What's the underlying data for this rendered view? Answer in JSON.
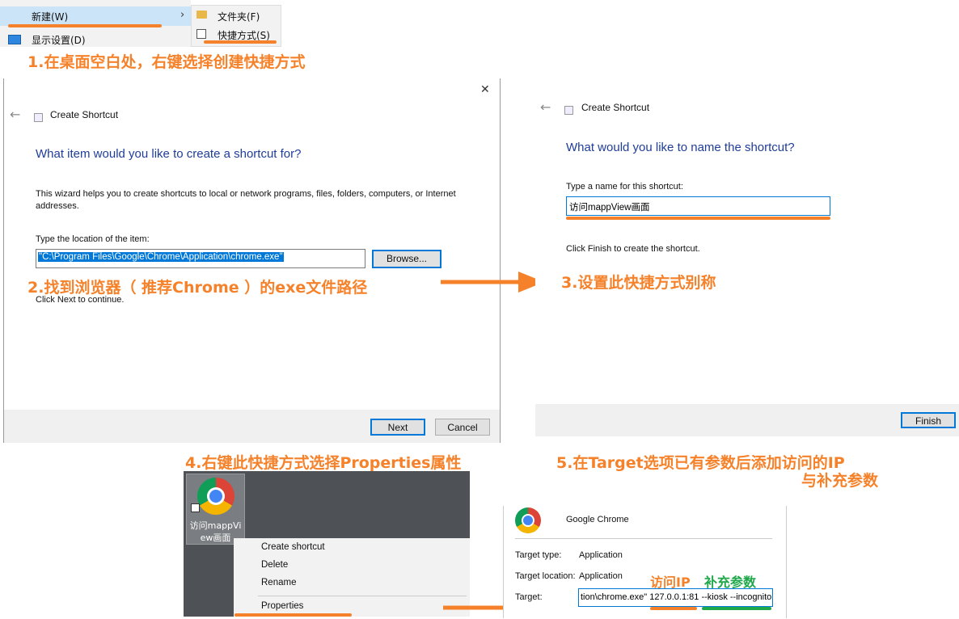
{
  "colors": {
    "accent": "#f5822a",
    "green": "#1fa84a",
    "wizard_blue": "#1f3d99",
    "selection": "#0078d7"
  },
  "context_menu_top": {
    "new_label": "新建(W)",
    "display_settings_label": "显示设置(D)",
    "submenu": [
      {
        "label": "文件夹(F)",
        "icon": "folder-icon"
      },
      {
        "label": "快捷方式(S)",
        "icon": "shortcut-icon"
      }
    ]
  },
  "steps": {
    "step1": "1.在桌面空白处，右键选择创建快捷方式",
    "step2": "2.找到浏览器（ 推荐Chrome ）的exe文件路径",
    "step3": "3.设置此快捷方式别称",
    "step4": "4.右键此快捷方式选择Properties属性",
    "step5_line1": "5.在Target选项已有参数后添加访问的IP",
    "step5_line2": "与补充参数"
  },
  "wizard1": {
    "title": "Create Shortcut",
    "heading": "What item would you like to create a shortcut for?",
    "description": "This wizard helps you to create shortcuts to local or network programs, files, folders, computers, or Internet addresses.",
    "location_label": "Type the location of the item:",
    "location_value": "\"C:\\Program Files\\Google\\Chrome\\Application\\chrome.exe\"",
    "browse_label": "Browse...",
    "continue_text": "Click Next to continue.",
    "next_label": "Next",
    "cancel_label": "Cancel",
    "close_glyph": "✕"
  },
  "wizard2": {
    "title": "Create Shortcut",
    "heading": "What would you like to name the shortcut?",
    "name_label": "Type a name for this shortcut:",
    "name_value": "访问mappView画面",
    "finish_text": "Click Finish to create the shortcut.",
    "finish_label": "Finish"
  },
  "desktop": {
    "icon_label": "访问mappView画面",
    "context_menu": [
      "Create shortcut",
      "Delete",
      "Rename",
      "Properties"
    ]
  },
  "properties": {
    "app_name": "Google Chrome",
    "target_type_label": "Target type:",
    "target_type_value": "Application",
    "target_location_label": "Target location:",
    "target_location_value": "Application",
    "target_label": "Target:",
    "target_value": "tion\\chrome.exe\" 127.0.0.1:81 --kiosk --incognito",
    "annotation_ip": "访问IP",
    "annotation_params": "补充参数"
  }
}
